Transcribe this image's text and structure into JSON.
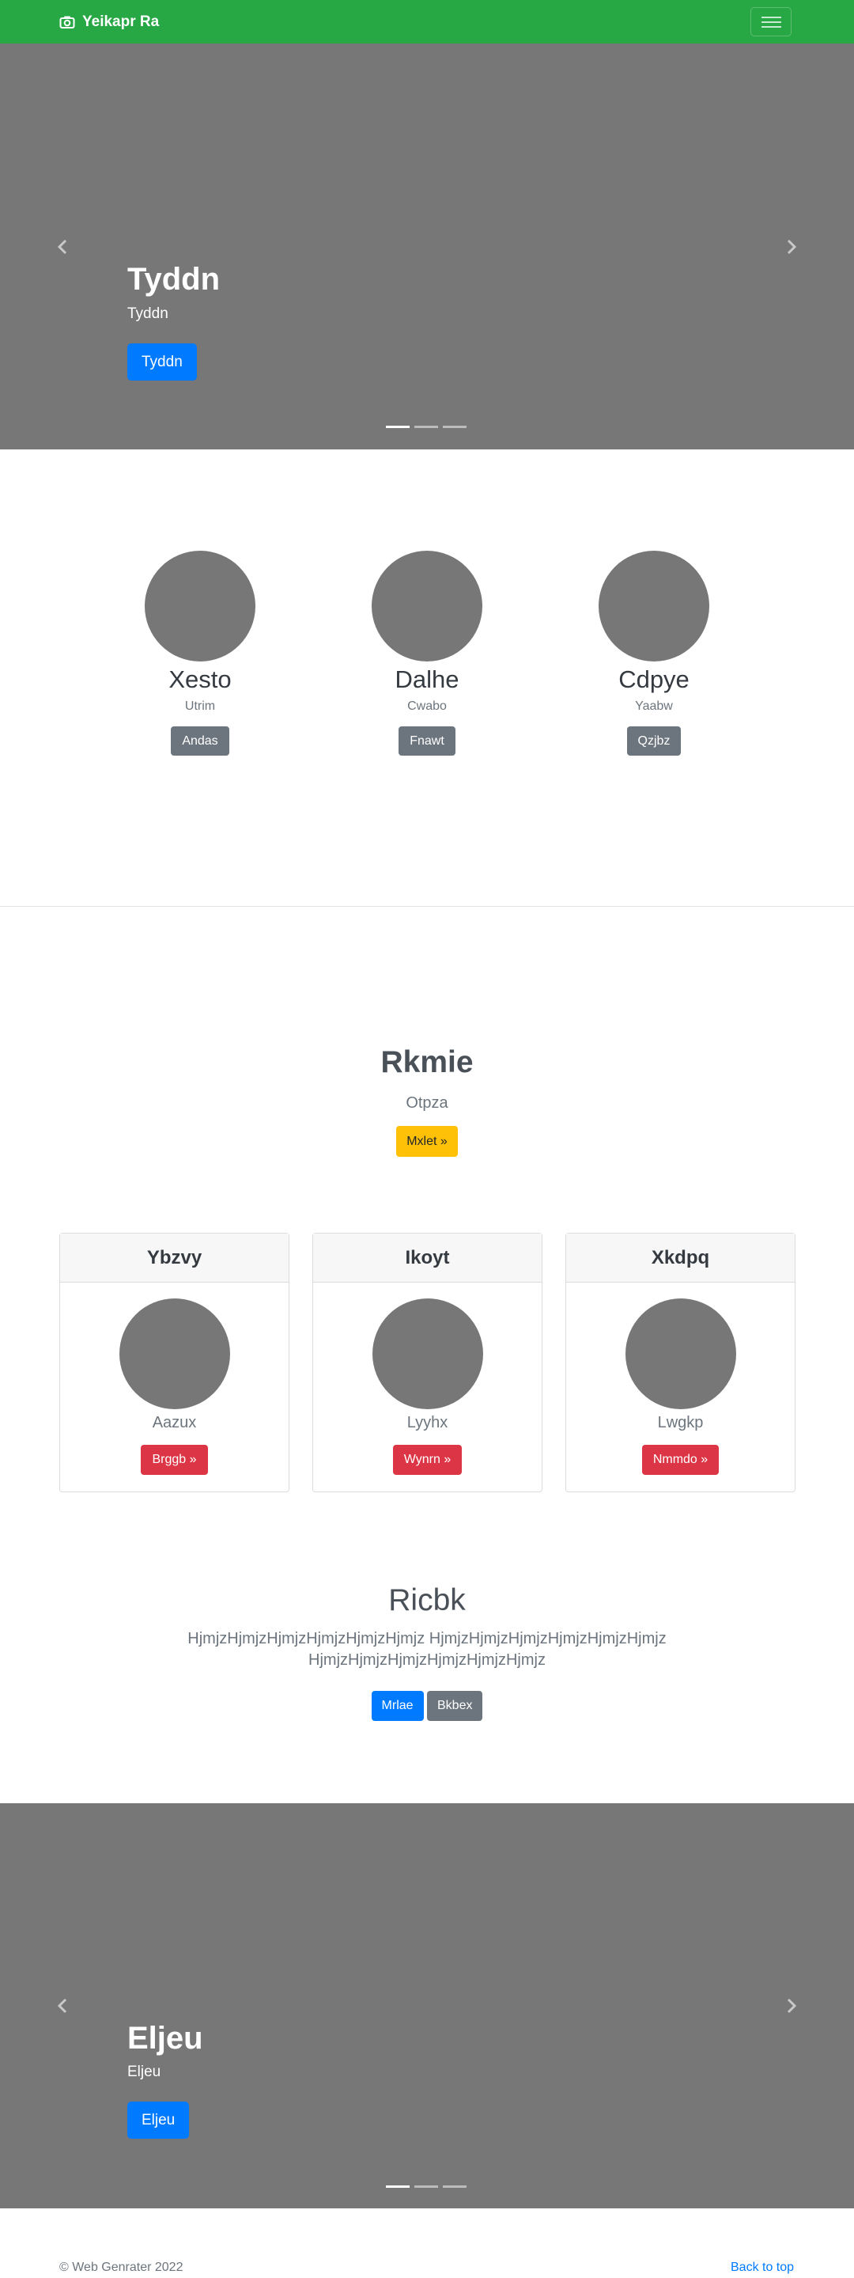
{
  "navbar": {
    "brand": "Yeikapr Ra",
    "brand_icon": "camera-icon",
    "toggler_icon": "hamburger-icon",
    "bg_color": "#28a745"
  },
  "hero": {
    "title": "Tyddn",
    "subtitle": "Tyddn",
    "button": "Tyddn",
    "slides": 3,
    "active_slide": 1
  },
  "team": [
    {
      "name": "Xesto",
      "sub": "Utrim",
      "button": "Andas"
    },
    {
      "name": "Dalhe",
      "sub": "Cwabo",
      "button": "Fnawt"
    },
    {
      "name": "Cdpye",
      "sub": "Yaabw",
      "button": "Qzjbz"
    }
  ],
  "feature": {
    "title": "Rkmie",
    "subtitle": "Otpza",
    "button": "Mxlet »"
  },
  "cards": [
    {
      "header": "Ybzvy",
      "label": "Aazux",
      "button": "Brggb »"
    },
    {
      "header": "Ikoyt",
      "label": "Lyyhx",
      "button": "Wynrn »"
    },
    {
      "header": "Xkdpq",
      "label": "Lwgkp",
      "button": "Nmmdo »"
    }
  ],
  "jumbotron": {
    "title": "Ricbk",
    "text_line1": "HjmjzHjmjzHjmjzHjmjzHjmjzHjmjz HjmjzHjmjzHjmjzHjmjzHjmjzHjmjz",
    "text_line2": "HjmjzHjmjzHjmjzHjmjzHjmjzHjmjz",
    "primary_button": "Mrlae",
    "secondary_button": "Bkbex"
  },
  "hero2": {
    "title": "Eljeu",
    "subtitle": "Eljeu",
    "button": "Eljeu",
    "slides": 3,
    "active_slide": 1
  },
  "footer": {
    "copyright": "© Web Genrater 2022",
    "back_to_top": "Back to top"
  }
}
